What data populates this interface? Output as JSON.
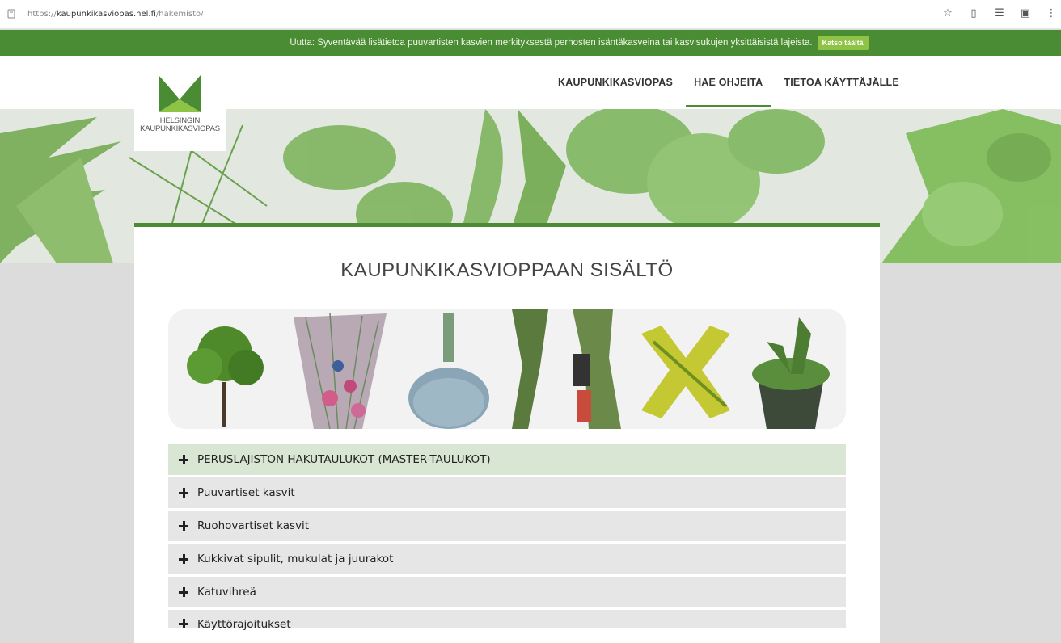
{
  "browser": {
    "url_prefix": "https://",
    "url_host": "kaupunkikasviopas.hel.fi",
    "url_path": "/hakemisto/"
  },
  "notice": {
    "text": "Uutta: Syventävää lisätietoa puuvartisten kasvien merkityksestä perhosten isäntäkasveina tai kasvisukujen yksittäisistä lajeista.",
    "button": "Katso täältä"
  },
  "logo": {
    "line1": "HELSINGIN",
    "line2": "KAUPUNKIKASVIOPAS"
  },
  "nav": {
    "items": [
      {
        "label": "KAUPUNKIKASVIOPAS"
      },
      {
        "label": "HAE OHJEITA"
      },
      {
        "label": "TIETOA KÄYTTÄJÄLLE"
      }
    ]
  },
  "main": {
    "title": "KAUPUNKIKASVIOPPAAN SISÄLTÖ",
    "sections": [
      {
        "label": "PERUSLAJISTON HAKUTAULUKOT (MASTER-TAULUKOT)"
      },
      {
        "label": "Puuvartiset kasvit"
      },
      {
        "label": "Ruohovartiset kasvit"
      },
      {
        "label": "Kukkivat sipulit, mukulat ja juurakot"
      },
      {
        "label": "Katuvihreä"
      },
      {
        "label": "Käyttörajoitukset"
      }
    ]
  },
  "colors": {
    "brand_green": "#4a8c33",
    "accent_green": "#8fc346",
    "highlight_row": "#d9e6d3"
  }
}
